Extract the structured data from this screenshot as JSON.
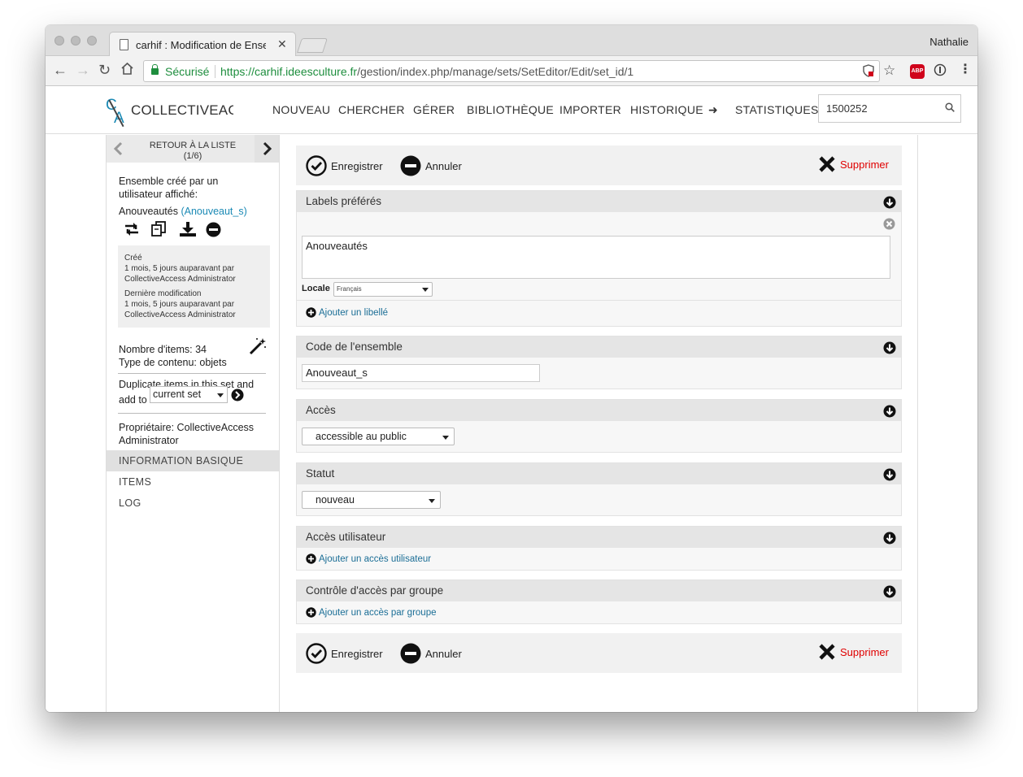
{
  "browser": {
    "tab_title": "carhif : Modification de Ensemble",
    "profile_name": "Nathalie",
    "secure_label": "Sécurisé",
    "url_scheme_host": "https://carhif.ideesculture.fr",
    "url_path": "/gestion/index.php/manage/sets/SetEditor/Edit/set_id/1",
    "abp_label": "ABP"
  },
  "header": {
    "logo_text": "COLLECTIVEACCESS",
    "nav": [
      "NOUVEAU",
      "CHERCHER",
      "GÉRER",
      "BIBLIOTHÈQUE",
      "IMPORTER",
      "HISTORIQUE",
      "➜",
      "STATISTIQUES"
    ],
    "search_value": "1500252"
  },
  "sidebar": {
    "back_label": "RETOUR À LA LISTE",
    "back_count": "(1/6)",
    "created_by_label": "Ensemble créé par un utilisateur affiché:",
    "set_name": "Anouveautés",
    "set_code_link": "(Anouveaut_s)",
    "created_label": "Créé",
    "created_value": "1 mois, 5 jours auparavant par CollectiveAccess Administrator",
    "modified_label": "Dernière modification",
    "modified_value": "1 mois, 5 jours auparavant par CollectiveAccess Administrator",
    "item_count": "Nombre d'items: 34",
    "content_type": "Type de contenu: objets",
    "duplicate_line1": "Duplicate items in this set and",
    "duplicate_add_to": "add to",
    "duplicate_select": "current set",
    "owner": "Propriétaire: CollectiveAccess Administrator",
    "nav": [
      "INFORMATION BASIQUE",
      "ITEMS",
      "LOG"
    ]
  },
  "actions": {
    "save": "Enregistrer",
    "cancel": "Annuler",
    "delete": "Supprimer"
  },
  "panels": {
    "labels": {
      "title": "Labels préférés",
      "value": "Anouveautés",
      "locale_label": "Locale",
      "locale_value": "Français",
      "add_link": "Ajouter un libellé"
    },
    "code": {
      "title": "Code de l'ensemble",
      "value": "Anouveaut_s"
    },
    "access": {
      "title": "Accès",
      "value": "accessible au public"
    },
    "status": {
      "title": "Statut",
      "value": "nouveau"
    },
    "user_access": {
      "title": "Accès utilisateur",
      "add_link": "Ajouter un accès utilisateur"
    },
    "group_access": {
      "title": "Contrôle d'accès par groupe",
      "add_link": "Ajouter un accès par groupe"
    }
  },
  "colors": {
    "accent": "#1b8ab5",
    "delete": "#e00000",
    "secure": "#1e8e3e"
  }
}
